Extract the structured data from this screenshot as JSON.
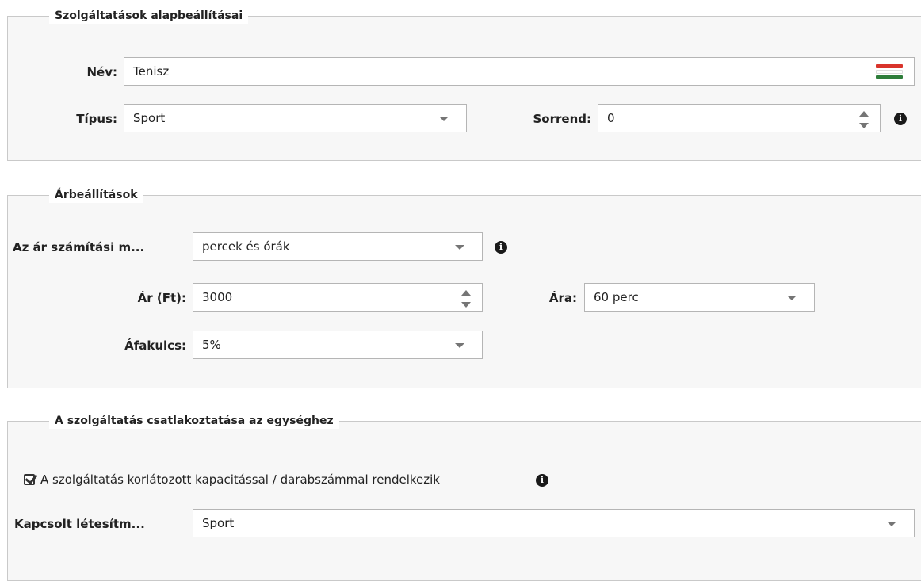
{
  "section_basic": {
    "legend": "Szolgáltatások alapbeállításai",
    "name_label": "Név:",
    "name_value": "Tenisz",
    "type_label": "Típus:",
    "type_value": "Sport",
    "order_label": "Sorrend:",
    "order_value": "0",
    "flag_icon": "hungarian-flag-icon",
    "flag_colors": [
      "#d9342b",
      "#ffffff",
      "#2e7d3a"
    ]
  },
  "section_price": {
    "legend": "Árbeállítások",
    "calc_label": "Az ár számítási m...",
    "calc_value": "percek és órák",
    "price_label": "Ár (Ft):",
    "price_value": "3000",
    "per_label": "Ára:",
    "per_value": "60 perc",
    "vat_label": "Áfakulcs:",
    "vat_value": "5%"
  },
  "section_link": {
    "legend": "A szolgáltatás csatlakoztatása az egységhez",
    "capacity_checkbox_label": "A szolgáltatás korlátozott kapacitással / darabszámmal rendelkezik",
    "capacity_checked": true,
    "facility_label": "Kapcsolt létesítm...",
    "facility_value": "Sport"
  },
  "icons": {
    "info": "i",
    "dropdown": "chevron-down-icon",
    "spinner": "spinner-icon"
  }
}
